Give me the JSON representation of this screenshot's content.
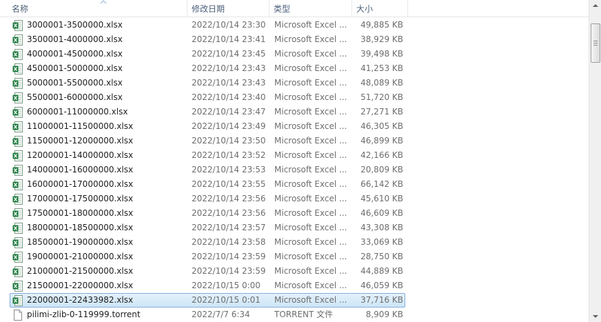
{
  "columns": {
    "name": "名称",
    "date": "修改日期",
    "type": "类型",
    "size": "大小"
  },
  "colors": {
    "excel": "#1d7a3e",
    "selection": "#cde6f7",
    "header_text": "#4c607a"
  },
  "files": [
    {
      "name": "3000001-3500000.xlsx",
      "date": "2022/10/14 23:30",
      "type": "Microsoft Excel ...",
      "size": "49,885 KB",
      "icon": "excel-file-icon",
      "selected": false
    },
    {
      "name": "3500001-4000000.xlsx",
      "date": "2022/10/14 23:41",
      "type": "Microsoft Excel ...",
      "size": "38,929 KB",
      "icon": "excel-file-icon",
      "selected": false
    },
    {
      "name": "4000001-4500000.xlsx",
      "date": "2022/10/14 23:45",
      "type": "Microsoft Excel ...",
      "size": "39,498 KB",
      "icon": "excel-file-icon",
      "selected": false
    },
    {
      "name": "4500001-5000000.xlsx",
      "date": "2022/10/14 23:43",
      "type": "Microsoft Excel ...",
      "size": "41,253 KB",
      "icon": "excel-file-icon",
      "selected": false
    },
    {
      "name": "5000001-5500000.xlsx",
      "date": "2022/10/14 23:43",
      "type": "Microsoft Excel ...",
      "size": "48,089 KB",
      "icon": "excel-file-icon",
      "selected": false
    },
    {
      "name": "5500001-6000000.xlsx",
      "date": "2022/10/14 23:40",
      "type": "Microsoft Excel ...",
      "size": "51,720 KB",
      "icon": "excel-file-icon",
      "selected": false
    },
    {
      "name": "6000001-11000000.xlsx",
      "date": "2022/10/14 23:47",
      "type": "Microsoft Excel ...",
      "size": "27,271 KB",
      "icon": "excel-file-icon",
      "selected": false
    },
    {
      "name": "11000001-11500000.xlsx",
      "date": "2022/10/14 23:49",
      "type": "Microsoft Excel ...",
      "size": "46,305 KB",
      "icon": "excel-file-icon",
      "selected": false
    },
    {
      "name": "11500001-12000000.xlsx",
      "date": "2022/10/14 23:50",
      "type": "Microsoft Excel ...",
      "size": "46,899 KB",
      "icon": "excel-file-icon",
      "selected": false
    },
    {
      "name": "12000001-14000000.xlsx",
      "date": "2022/10/14 23:52",
      "type": "Microsoft Excel ...",
      "size": "42,166 KB",
      "icon": "excel-file-icon",
      "selected": false
    },
    {
      "name": "14000001-16000000.xlsx",
      "date": "2022/10/14 23:53",
      "type": "Microsoft Excel ...",
      "size": "20,809 KB",
      "icon": "excel-file-icon",
      "selected": false
    },
    {
      "name": "16000001-17000000.xlsx",
      "date": "2022/10/14 23:55",
      "type": "Microsoft Excel ...",
      "size": "66,142 KB",
      "icon": "excel-file-icon",
      "selected": false
    },
    {
      "name": "17000001-17500000.xlsx",
      "date": "2022/10/14 23:56",
      "type": "Microsoft Excel ...",
      "size": "45,610 KB",
      "icon": "excel-file-icon",
      "selected": false
    },
    {
      "name": "17500001-18000000.xlsx",
      "date": "2022/10/14 23:56",
      "type": "Microsoft Excel ...",
      "size": "46,609 KB",
      "icon": "excel-file-icon",
      "selected": false
    },
    {
      "name": "18000001-18500000.xlsx",
      "date": "2022/10/14 23:57",
      "type": "Microsoft Excel ...",
      "size": "43,308 KB",
      "icon": "excel-file-icon",
      "selected": false
    },
    {
      "name": "18500001-19000000.xlsx",
      "date": "2022/10/14 23:58",
      "type": "Microsoft Excel ...",
      "size": "33,069 KB",
      "icon": "excel-file-icon",
      "selected": false
    },
    {
      "name": "19000001-21000000.xlsx",
      "date": "2022/10/14 23:59",
      "type": "Microsoft Excel ...",
      "size": "28,750 KB",
      "icon": "excel-file-icon",
      "selected": false
    },
    {
      "name": "21000001-21500000.xlsx",
      "date": "2022/10/14 23:59",
      "type": "Microsoft Excel ...",
      "size": "44,889 KB",
      "icon": "excel-file-icon",
      "selected": false
    },
    {
      "name": "21500001-22000000.xlsx",
      "date": "2022/10/15 0:00",
      "type": "Microsoft Excel ...",
      "size": "46,059 KB",
      "icon": "excel-file-icon",
      "selected": false
    },
    {
      "name": "22000001-22433982.xlsx",
      "date": "2022/10/15 0:01",
      "type": "Microsoft Excel ...",
      "size": "37,716 KB",
      "icon": "excel-file-icon",
      "selected": true
    },
    {
      "name": "pilimi-zlib-0-119999.torrent",
      "date": "2022/7/7 6:34",
      "type": "TORRENT 文件",
      "size": "8,909 KB",
      "icon": "torrent-file-icon",
      "selected": false
    }
  ]
}
